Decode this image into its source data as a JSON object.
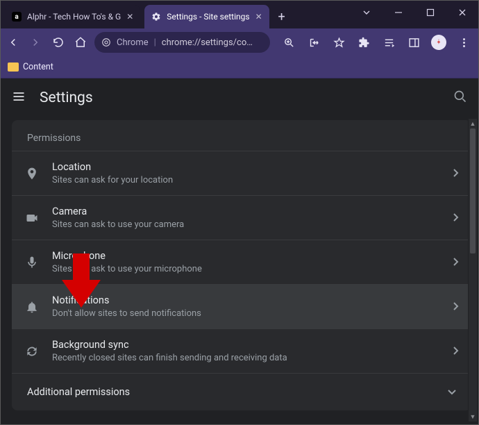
{
  "tabs": [
    {
      "title": "Alphr - Tech How To's & G",
      "favicon": "a",
      "active": false
    },
    {
      "title": "Settings - Site settings",
      "favicon": "gear",
      "active": true
    }
  ],
  "omnibox": {
    "scheme_label": "Chrome",
    "url_display": "chrome://settings/co…"
  },
  "bookmarks": [
    {
      "label": "Content"
    }
  ],
  "settings_header": {
    "title": "Settings"
  },
  "permissions": {
    "section_label": "Permissions",
    "items": [
      {
        "icon": "location",
        "title": "Location",
        "sub": "Sites can ask for your location"
      },
      {
        "icon": "camera",
        "title": "Camera",
        "sub": "Sites can ask to use your camera"
      },
      {
        "icon": "microphone",
        "title": "Microphone",
        "sub": "Sites can ask to use your microphone"
      },
      {
        "icon": "bell",
        "title": "Notifications",
        "sub": "Don't allow sites to send notifications",
        "hovered": true
      },
      {
        "icon": "sync",
        "title": "Background sync",
        "sub": "Recently closed sites can finish sending and receiving data"
      }
    ],
    "additional_label": "Additional permissions"
  }
}
